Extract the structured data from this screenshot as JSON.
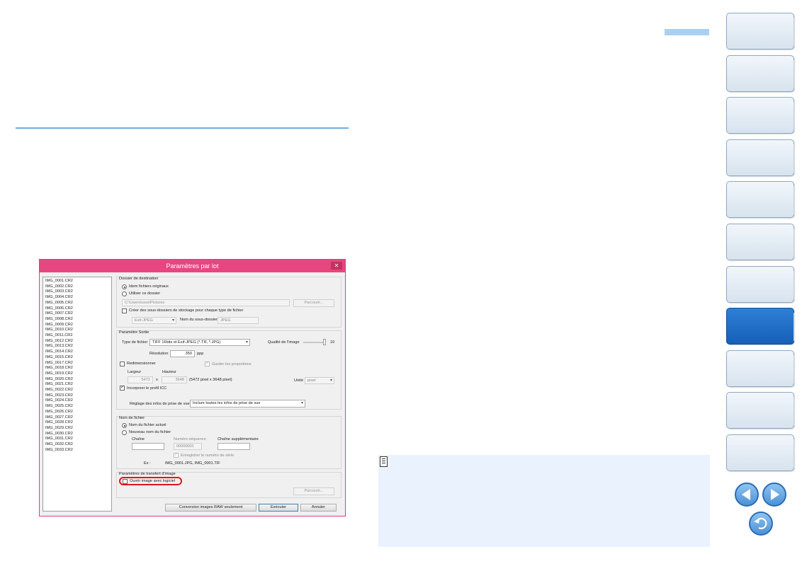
{
  "colors": {
    "accent": "#6aaee6",
    "nav_active": "#1f6cc4",
    "highlight": "#e0161b",
    "note_bg": "#eaf2fd",
    "dialog_title": "#e8467f"
  },
  "nav": {
    "buttons": [
      "",
      "",
      "",
      "",
      "",
      "",
      "",
      "",
      "",
      "",
      ""
    ],
    "active_index": 7,
    "prev_icon": "triangle-left-icon",
    "next_icon": "triangle-right-icon",
    "return_icon": "return-arrow-icon"
  },
  "dialog": {
    "title": "Paramètres par lot",
    "close": "✕",
    "files": [
      "IMG_0001.CR2",
      "IMG_0002.CR2",
      "IMG_0003.CR2",
      "IMG_0004.CR2",
      "IMG_0005.CR2",
      "IMG_0006.CR2",
      "IMG_0007.CR2",
      "IMG_0008.CR2",
      "IMG_0009.CR2",
      "IMG_0010.CR2",
      "IMG_0011.CR2",
      "IMG_0012.CR2",
      "IMG_0013.CR2",
      "IMG_0014.CR2",
      "IMG_0015.CR2",
      "IMG_0017.CR2",
      "IMG_0018.CR2",
      "IMG_0019.CR2",
      "IMG_0020.CR2",
      "IMG_0021.CR2",
      "IMG_0022.CR2",
      "IMG_0023.CR2",
      "IMG_0024.CR2",
      "IMG_0025.CR2",
      "IMG_0026.CR2",
      "IMG_0027.CR2",
      "IMG_0028.CR2",
      "IMG_0029.CR2",
      "IMG_0030.CR2",
      "IMG_0031.CR2",
      "IMG_0032.CR2",
      "IMG_0033.CR2"
    ],
    "dest": {
      "heading": "Dossier de destination",
      "opt_same": "Idem fichiers originaux",
      "opt_use": "Utiliser ce dossier",
      "path": "C:\\Users\\xxxx\\Pictures",
      "browse": "Parcourir...",
      "create_sub": "Créer des sous-dossiers de stockage pour chaque type de fichier",
      "sub_type": "Exif-JPEG",
      "sub_name_label": "Nom du sous-dossier",
      "sub_name": "JPEG"
    },
    "output": {
      "heading": "Paramètre Sortie",
      "type_label": "Type de fichier",
      "type_value": "TIFF 16bits et Exif-JPEG (*.TIF, *.JPG)",
      "quality_label": "Qualité de l'image",
      "quality_value": "10",
      "quality_level": 1.0,
      "resolution_label": "Résolution",
      "resolution_value": "350",
      "resolution_unit": "ppp",
      "resize": "Redimensionner",
      "keep_ratio": "Garder les proportions",
      "width_label": "Largeur",
      "height_label": "Hauteur",
      "width": "5472",
      "times": "x",
      "height": "3648",
      "pixels_note": "(5472 pixel x 3648 pixel)",
      "unit_label": "Unité",
      "unit_value": "pixel",
      "icc": "Incorporer le profil ICC",
      "shot_label": "Réglage des infos de prise de vue",
      "shot_value": "Inclure toutes les infos de prise de vue"
    },
    "filename": {
      "heading": "Nom de fichier",
      "opt_current": "Nom du fichier actuel",
      "opt_new": "Nouveau nom du fichier",
      "chain_label": "Chaîne",
      "seq_label": "Numéro séquence",
      "seq_value": "00000001",
      "extra_label": "Chaîne supplémentaire",
      "save_seq": "Enregistrer le numéro de série",
      "example_label": "Ex :",
      "example_value": "IMG_0001.JPG, IMG_0001.TIF"
    },
    "transfer": {
      "heading": "Paramètres de transfert d'image",
      "open_with": "Ouvrir image avec logiciel",
      "browse": "Parcourir..."
    },
    "buttons": {
      "raw_only": "Conversion images RAW seulement",
      "run": "Exécuter",
      "cancel": "Annuler"
    }
  }
}
